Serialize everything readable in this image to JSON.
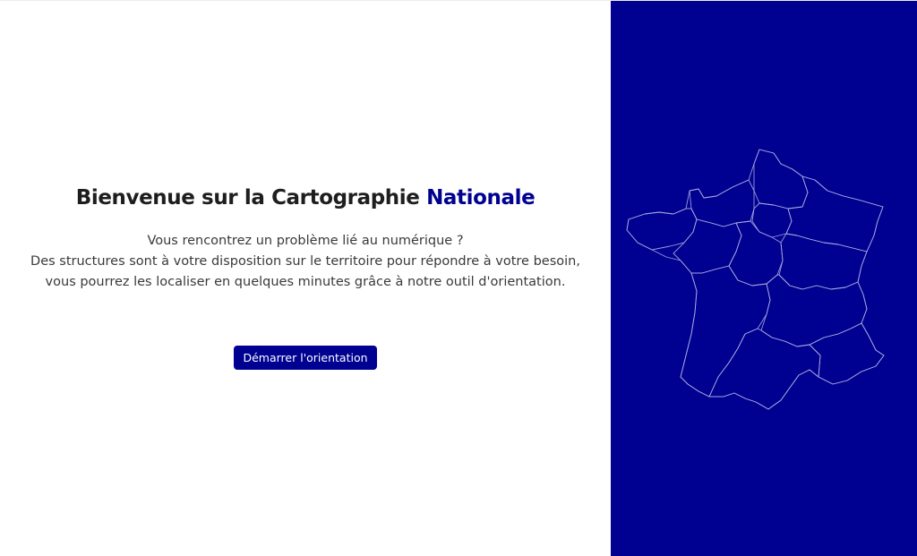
{
  "hero": {
    "title_main": "Bienvenue sur la Cartographie",
    "title_accent": "Nationale",
    "description_lines": [
      "Vous rencontrez un problème lié au numérique ?",
      "Des structures sont à votre disposition sur le territoire pour répondre à votre besoin,",
      "vous pourrez les localiser en quelques minutes grâce à notre outil d'orientation."
    ],
    "start_button_label": "Démarrer l'orientation"
  },
  "colors": {
    "brand": "#000091",
    "panel_background": "#000091",
    "text": "#1e1e1e",
    "map_stroke": "#a8abe0"
  },
  "map": {
    "icon": "france-regions-map"
  }
}
